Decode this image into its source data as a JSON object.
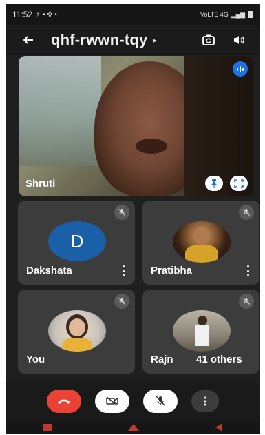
{
  "status_bar": {
    "time": "11:52",
    "network_label": "VoLTE 4G"
  },
  "header": {
    "meeting_code": "qhf-rwwn-tqy"
  },
  "main_tile": {
    "name": "Shruti"
  },
  "tiles": [
    {
      "name": "Dakshata",
      "avatar_letter": "D",
      "avatar_color": "#1a5fa8"
    },
    {
      "name": "Pratibha"
    },
    {
      "name": "You"
    },
    {
      "name": "Rajn",
      "others_label": "41 others"
    }
  ],
  "colors": {
    "end_call": "#ea4335",
    "speaking_accent": "#1a73e8",
    "tile_bg": "#3c3c3c"
  },
  "icons": [
    "back-arrow-icon",
    "switch-camera-icon",
    "speaker-icon",
    "pin-icon",
    "fullscreen-icon",
    "mic-off-icon",
    "more-icon",
    "end-call-icon",
    "camera-off-icon"
  ]
}
